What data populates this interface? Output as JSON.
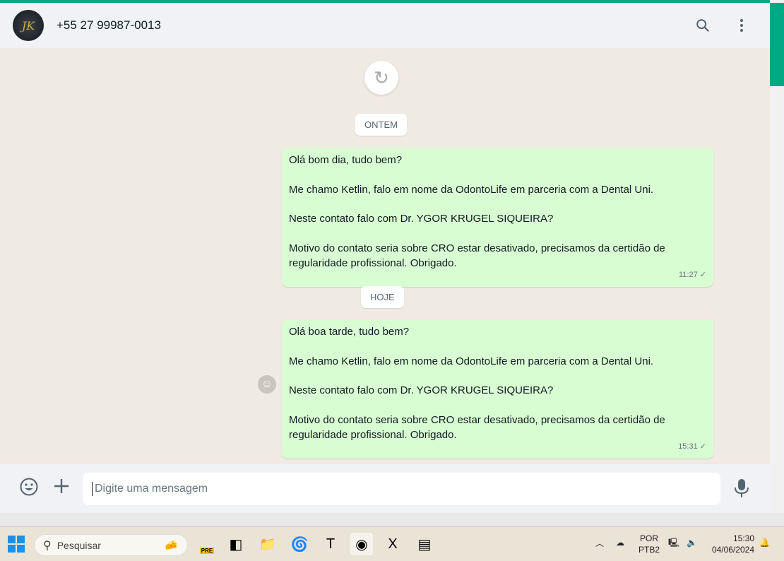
{
  "header": {
    "avatar_initials": "JK",
    "contact": "+55 27 99987-0013"
  },
  "chat": {
    "groups": [
      {
        "date": "ONTEM",
        "message": {
          "lines": [
            "Olá bom dia, tudo bem?",
            "Me chamo Ketlin, falo em nome da OdontoLife em parceria com a Dental Uni.",
            "Neste contato falo com Dr. YGOR KRUGEL SIQUEIRA?",
            "Motivo do contato seria sobre CRO estar desativado, precisamos da certidão de regularidade profissional. Obrigado."
          ],
          "time": "11:27"
        }
      },
      {
        "date": "HOJE",
        "message": {
          "lines": [
            "Olá boa tarde, tudo bem?",
            "Me chamo Ketlin, falo em nome da OdontoLife em parceria com a Dental Uni.",
            "Neste contato falo com Dr. YGOR KRUGEL SIQUEIRA?",
            "Motivo do contato seria sobre CRO estar desativado, precisamos da certidão de regularidade profissional. Obrigado."
          ],
          "time": "15:31"
        }
      }
    ]
  },
  "composer": {
    "placeholder": "Digite uma mensagem"
  },
  "taskbar": {
    "search": "Pesquisar",
    "copilot_badge": "PRE",
    "lang": "POR",
    "layout": "PTB2",
    "time": "15:30",
    "date": "04/06/2024"
  },
  "colors": {
    "accent": "#00a884",
    "bubble": "#d9fdd3"
  }
}
